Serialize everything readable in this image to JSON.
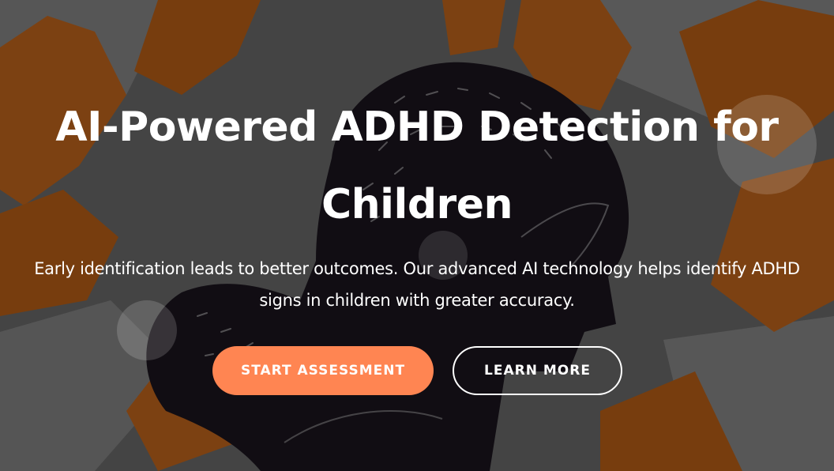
{
  "hero": {
    "title": "AI-Powered ADHD Detection for Children",
    "subtitle": "Early identification leads to better outcomes. Our advanced AI technology helps identify ADHD signs in children with greater accuracy.",
    "background_image": "child-head-silhouette-with-arrows-illustration"
  },
  "buttons": {
    "primary_label": "START ASSESSMENT",
    "secondary_label": "LEARN MORE"
  },
  "colors": {
    "accent": "#ff8552",
    "text": "#ffffff",
    "bg_orange": "#c2661e",
    "bg_gray": "#8a8a8a",
    "bg_dark": "#1c1620"
  }
}
